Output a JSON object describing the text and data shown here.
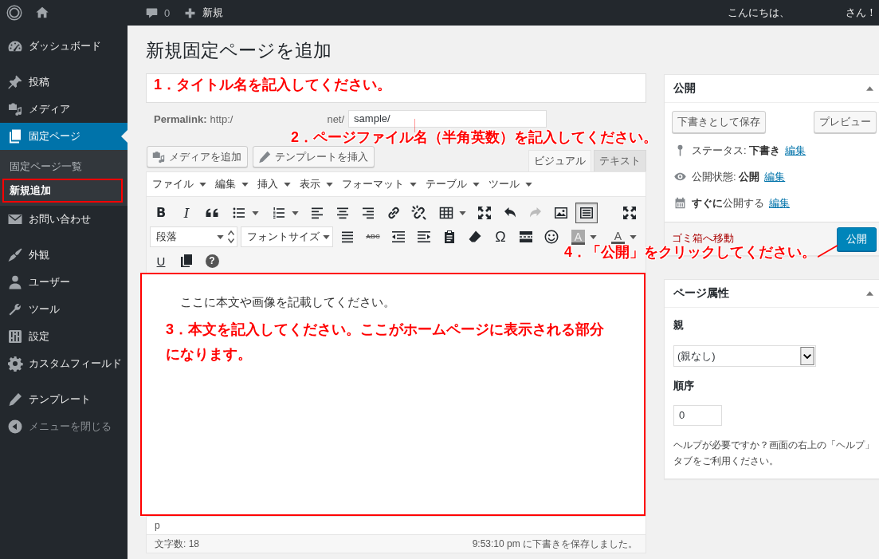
{
  "admin_bar": {
    "comments": "0",
    "new": "新規",
    "greeting": "こんにちは、",
    "greeting_end": "さん！"
  },
  "sidebar": {
    "groups": [
      {
        "items": [
          {
            "label": "ダッシュボード",
            "selected": false
          }
        ]
      },
      {
        "items": [
          {
            "label": "投稿",
            "selected": false
          },
          {
            "label": "メディア",
            "selected": false
          },
          {
            "label": "固定ページ",
            "selected": true,
            "children": [
              {
                "label": "固定ページ一覧",
                "selected": false,
                "highlighted": false
              },
              {
                "label": "新規追加",
                "selected": true,
                "highlighted": true
              }
            ]
          },
          {
            "label": "お問い合わせ",
            "selected": false
          }
        ]
      },
      {
        "items": [
          {
            "label": "外観",
            "selected": false
          },
          {
            "label": "ユーザー",
            "selected": false
          },
          {
            "label": "ツール",
            "selected": false
          },
          {
            "label": "設定",
            "selected": false
          },
          {
            "label": "カスタムフィールド",
            "selected": false
          }
        ]
      },
      {
        "items": [
          {
            "label": "テンプレート",
            "selected": false
          }
        ]
      }
    ],
    "collapse": "メニューを閉じる"
  },
  "page": {
    "heading": "新規固定ページを追加",
    "permalink": {
      "label": "Permalink:",
      "url_start": "http:/",
      "url_end": "net/",
      "slug": "sample/"
    },
    "media_buttons": [
      "メディアを追加",
      "テンプレートを挿入"
    ],
    "editor": {
      "tabs": [
        {
          "label": "ビジュアル",
          "selected": true
        },
        {
          "label": "テキスト",
          "selected": false
        }
      ],
      "menus": [
        "ファイル",
        "編集",
        "挿入",
        "表示",
        "フォーマット",
        "テーブル",
        "ツール"
      ],
      "toolbar": [
        [
          {
            "kind": "glyph",
            "text": "B",
            "disabled": false,
            "pressed": false
          },
          {
            "kind": "glyph",
            "text": "I",
            "disabled": false,
            "pressed": false
          },
          {
            "kind": "icon",
            "disabled": false,
            "pressed": false
          },
          {
            "kind": "icon",
            "dropdown": true,
            "disabled": false,
            "pressed": false
          },
          {
            "kind": "icon",
            "dropdown": true,
            "disabled": false,
            "pressed": false
          },
          {
            "kind": "icon",
            "disabled": false,
            "pressed": false
          },
          {
            "kind": "icon",
            "disabled": false,
            "pressed": false
          },
          {
            "kind": "icon",
            "disabled": false,
            "pressed": false
          },
          {
            "kind": "icon",
            "disabled": false,
            "pressed": false
          },
          {
            "kind": "icon",
            "disabled": false,
            "pressed": false
          },
          {
            "kind": "icon",
            "dropdown": true,
            "disabled": false,
            "pressed": false
          },
          {
            "kind": "icon",
            "disabled": false,
            "pressed": false
          },
          {
            "kind": "icon",
            "disabled": false,
            "pressed": false
          },
          {
            "kind": "icon",
            "disabled": true,
            "pressed": false
          },
          {
            "kind": "icon",
            "disabled": false,
            "pressed": false
          },
          {
            "kind": "icon",
            "disabled": false,
            "pressed": true
          },
          {
            "kind": "icon",
            "disabled": false,
            "pressed": false
          }
        ],
        [
          {
            "kind": "select",
            "value": "段落"
          },
          {
            "kind": "select",
            "value": "フォントサイズ"
          },
          {
            "kind": "icon",
            "disabled": false,
            "pressed": false
          },
          {
            "kind": "glyph",
            "text": "ABC",
            "disabled": false,
            "pressed": false
          },
          {
            "kind": "icon",
            "disabled": false,
            "pressed": false
          },
          {
            "kind": "icon",
            "disabled": false,
            "pressed": false
          },
          {
            "kind": "icon",
            "disabled": false,
            "pressed": false
          },
          {
            "kind": "icon",
            "disabled": false,
            "pressed": false
          },
          {
            "kind": "glyph",
            "text": "Ω",
            "disabled": false,
            "pressed": false
          },
          {
            "kind": "icon",
            "disabled": false,
            "pressed": false
          },
          {
            "kind": "icon",
            "disabled": false,
            "pressed": false
          },
          {
            "kind": "glyph",
            "text": "A",
            "dropdown": true,
            "disabled": false,
            "pressed": false
          },
          {
            "kind": "glyph",
            "text": "A",
            "dropdown": true,
            "disabled": false,
            "pressed": false
          }
        ],
        [
          {
            "kind": "glyph",
            "text": "U",
            "disabled": false,
            "pressed": false
          },
          {
            "kind": "icon",
            "disabled": false,
            "pressed": false
          },
          {
            "kind": "glyph",
            "text": "?",
            "disabled": false,
            "pressed": false
          }
        ]
      ],
      "content": {
        "text": "ここに本文や画像を記載してください。",
        "highlighted": true
      },
      "path": "p",
      "word_count": "文字数: 18",
      "autosave": "9:53:10 pm に下書きを保存しました。"
    }
  },
  "publish_box": {
    "title": "公開",
    "expanded": true,
    "save_draft": "下書きとして保存",
    "preview": "プレビュー",
    "rows": [
      {
        "text": "ステータス: **下書き**",
        "link": "編集"
      },
      {
        "text": "公開状態: **公開**",
        "link": "編集"
      },
      {
        "text": "**すぐに**公開する",
        "link": "編集"
      }
    ],
    "trash": "ゴミ箱へ移動",
    "publish": "公開"
  },
  "attributes_box": {
    "title": "ページ属性",
    "expanded": true,
    "parent_label": "親",
    "parent_value": "(親なし)",
    "order_label": "順序",
    "order_value": "0",
    "help": "ヘルプが必要ですか？画面の右上の「ヘルプ」タブをご利用ください。"
  },
  "annotations": [
    {
      "text": "1．タイトル名を記入してください。",
      "leader": false
    },
    {
      "text": "2．ページファイル名（半角英数）を記入してください。",
      "leader": true
    },
    {
      "text": "3．本文を記入してください。ここがホームページに表示される部分になります。",
      "leader": false
    },
    {
      "text": "4．「公開」をクリックしてください。",
      "leader": true
    }
  ]
}
